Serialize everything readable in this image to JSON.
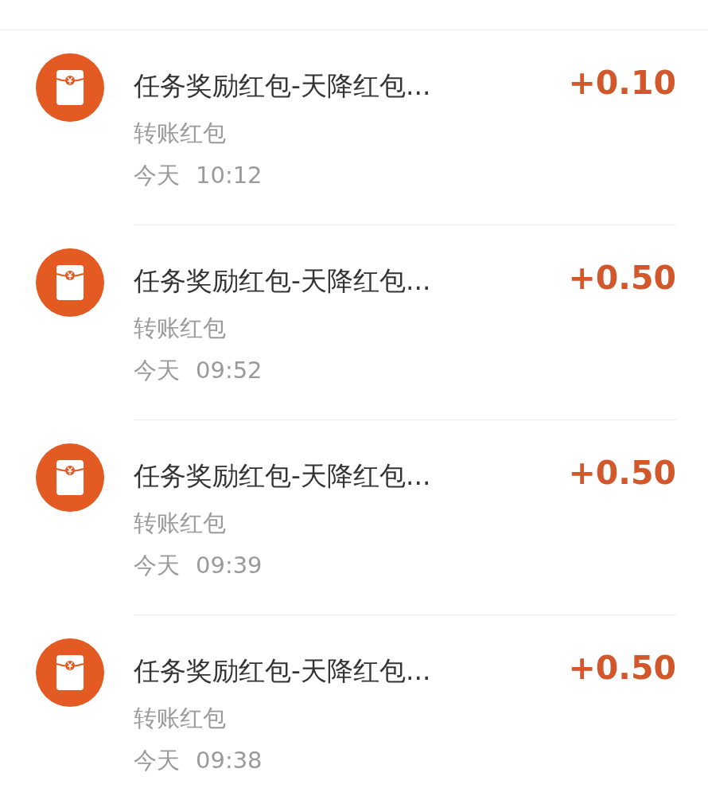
{
  "transactions": [
    {
      "title": "任务奖励红包-天降红包...",
      "type": "转账红包",
      "day": "今天",
      "time": "10:12",
      "amount": "+0.10"
    },
    {
      "title": "任务奖励红包-天降红包...",
      "type": "转账红包",
      "day": "今天",
      "time": "09:52",
      "amount": "+0.50"
    },
    {
      "title": "任务奖励红包-天降红包...",
      "type": "转账红包",
      "day": "今天",
      "time": "09:39",
      "amount": "+0.50"
    },
    {
      "title": "任务奖励红包-天降红包...",
      "type": "转账红包",
      "day": "今天",
      "time": "09:38",
      "amount": "+0.50"
    }
  ]
}
